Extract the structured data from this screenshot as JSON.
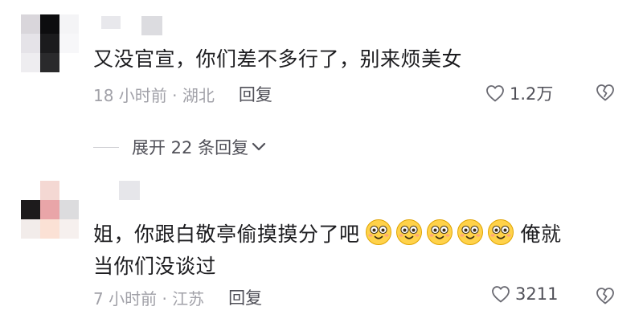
{
  "comments": [
    {
      "text": "又没官宣，你们差不多行了，别来烦美女",
      "time_location": "18 小时前 · 湖北",
      "reply_label": "回复",
      "like_count": "1.2万",
      "expand_label": "展开 22 条回复"
    },
    {
      "text_before": "姐，你跟白敬亭偷摸摸分了吧",
      "emoji_count": 5,
      "text_after": "俺就",
      "text_line2": "当你们没谈过",
      "time_location": "7 小时前 · 江苏",
      "reply_label": "回复",
      "like_count": "3211"
    }
  ],
  "colors": {
    "meta_gray": "#a1a1a8",
    "action_gray": "#505058",
    "text": "#1d1d20",
    "emoji_yellow": "#ffd24a"
  },
  "icons": {
    "like": "heart-outline-icon",
    "dislike": "broken-heart-icon",
    "expand": "chevron-down-icon",
    "emoji": "grinning-face-icon"
  }
}
